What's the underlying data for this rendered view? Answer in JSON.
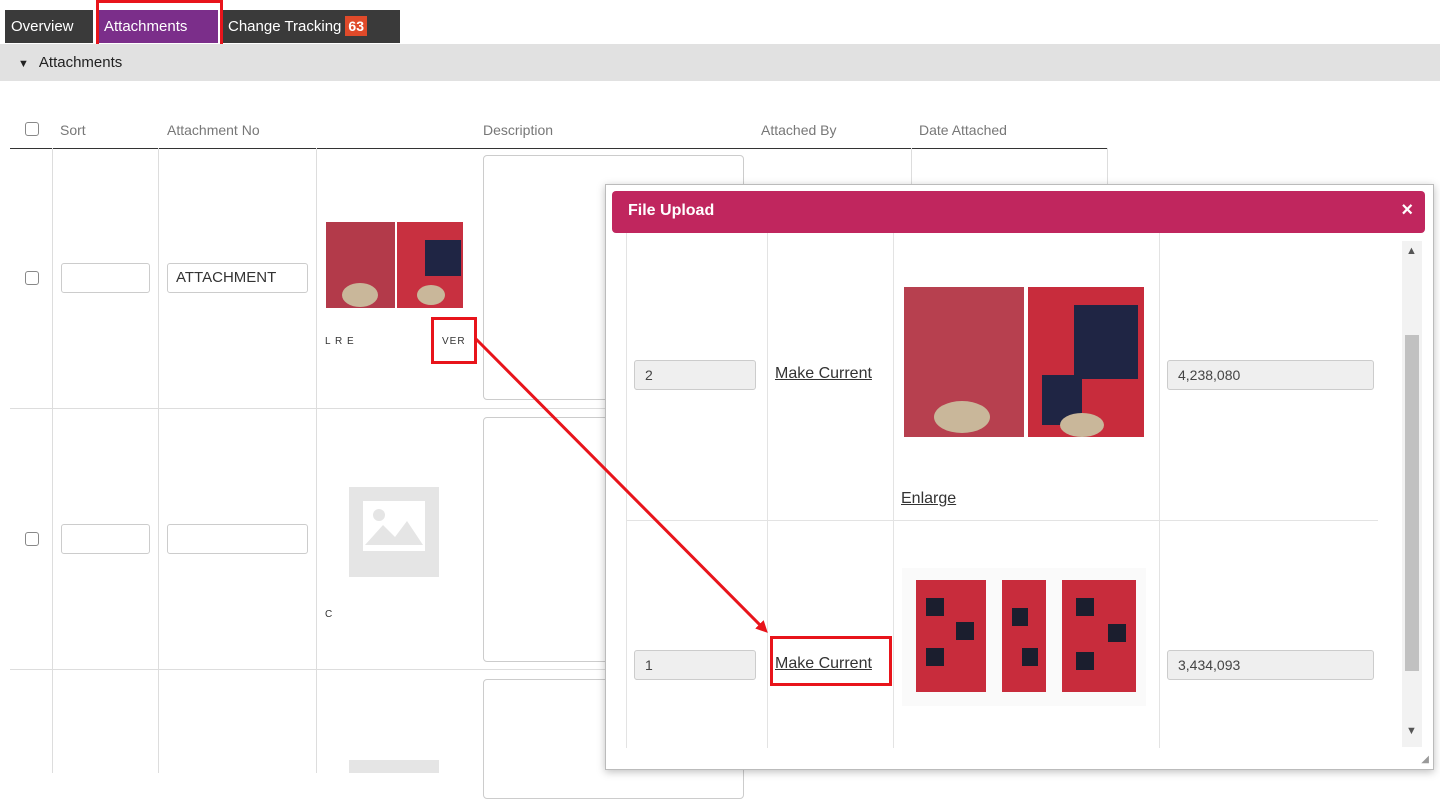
{
  "tabs": [
    {
      "label": "Overview"
    },
    {
      "label": "Attachments"
    },
    {
      "label": "Change Tracking",
      "badge": "63"
    }
  ],
  "section": {
    "title": "Attachments"
  },
  "table": {
    "headers": [
      "Sort",
      "Attachment No",
      "Description",
      "Attached By",
      "Date Attached"
    ],
    "rows": [
      {
        "sort": "",
        "attachment_no": "ATTACHMENT",
        "thumb_text_left": "L R E",
        "thumb_text_right": "VER"
      },
      {
        "sort": "",
        "attachment_no": "",
        "thumb_text_left": "C"
      },
      {
        "sort": "",
        "attachment_no": ""
      }
    ]
  },
  "modal": {
    "title": "File Upload",
    "close": "×",
    "rows": [
      {
        "version": "2",
        "action": "Make Current",
        "enlarge": "Enlarge",
        "size": "4,238,080"
      },
      {
        "version": "1",
        "action": "Make Current",
        "size": "3,434,093"
      }
    ]
  },
  "colors": {
    "accent": "#c0265e",
    "tab_active": "#7b2e8a",
    "annotation": "#e8141b"
  }
}
